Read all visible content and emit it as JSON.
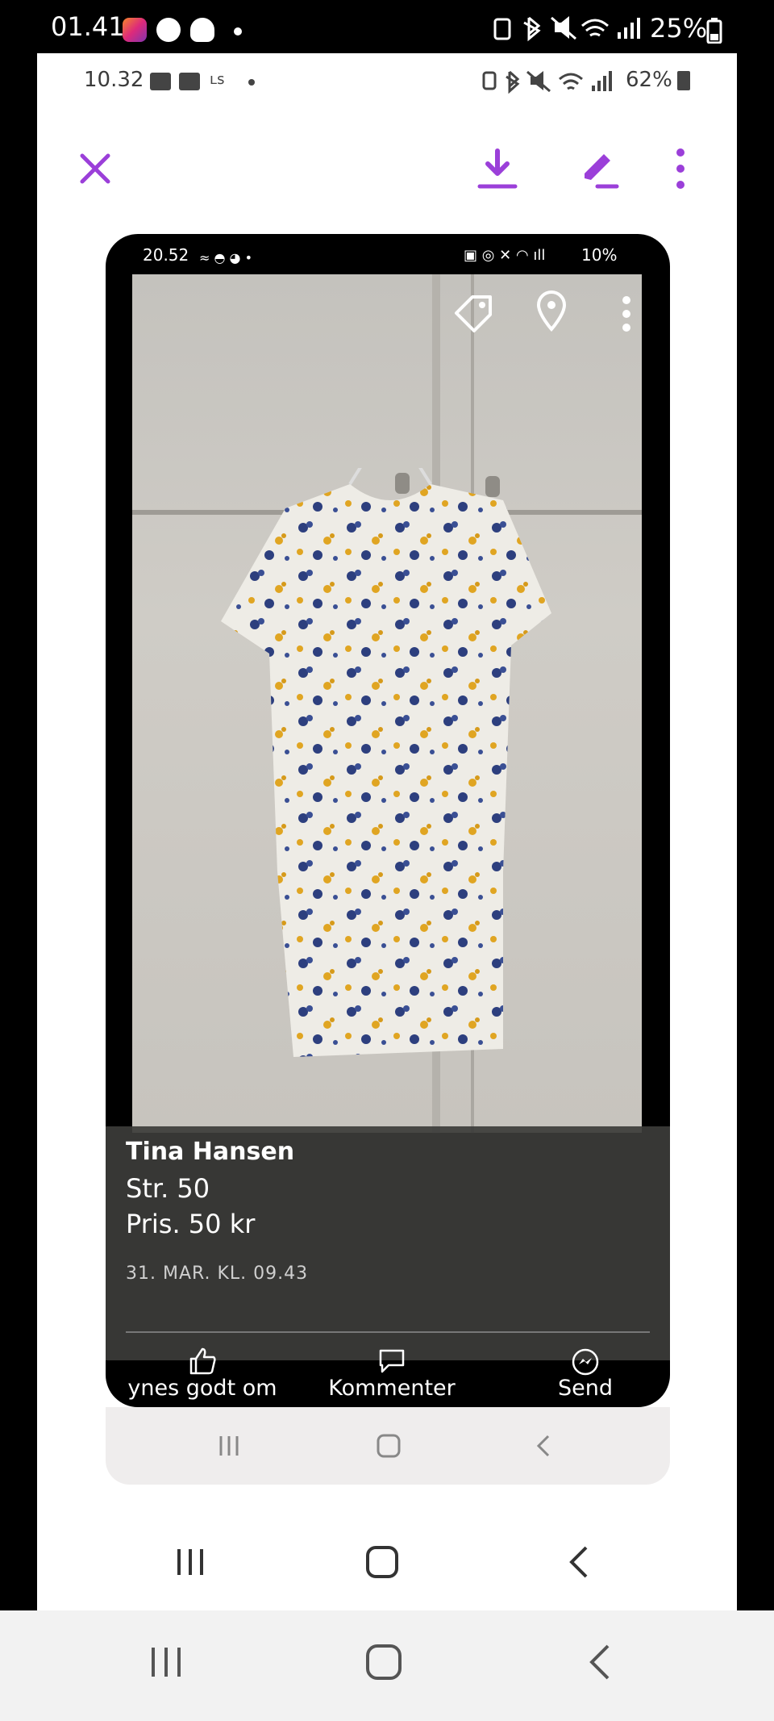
{
  "outer_status": {
    "time": "01.41",
    "battery": "25%"
  },
  "inner_status": {
    "time": "10.32",
    "battery": "62%"
  },
  "phone_status": {
    "time": "20.52",
    "battery": "10%"
  },
  "post": {
    "author": "Tina Hansen",
    "size_line": "Str. 50",
    "price_line": "Pris. 50 kr",
    "date": "31. MAR. KL. 09.43"
  },
  "actions": {
    "like": "ynes godt om",
    "comment": "Kommenter",
    "send": "Send"
  },
  "colors": {
    "accent": "#9b3fd9",
    "caption_bg": "#3c3c3a"
  },
  "icons": {
    "close": "close-icon",
    "download": "download-icon",
    "edit": "edit-icon",
    "more": "more-vertical-icon",
    "tag": "tag-icon",
    "location": "location-icon"
  }
}
